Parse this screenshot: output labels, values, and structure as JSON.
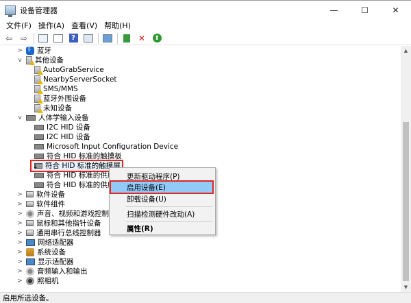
{
  "window": {
    "title": "设备管理器",
    "minimize_glyph": "—",
    "maximize_glyph": "☐",
    "close_glyph": "✕"
  },
  "menu": [
    "文件(F)",
    "操作(A)",
    "查看(V)",
    "帮助(H)"
  ],
  "toolbar": {
    "back_glyph": "⇦",
    "forward_glyph": "⇨",
    "help_glyph": "?",
    "uninstall_glyph": "✕",
    "update_glyph": "⬆"
  },
  "tree": {
    "bluetooth": "蓝牙",
    "other_devices": "其他设备",
    "other_children": [
      "AutoGrabService",
      "NearbyServerSocket",
      "SMS/MMS",
      "蓝牙外围设备",
      "未知设备"
    ],
    "hid": "人体学输入设备",
    "hid_children": [
      "I2C HID 设备",
      "I2C HID 设备",
      "Microsoft Input Configuration Device",
      "符合 HID 标准的触摸板",
      "符合 HID 标准的触摸屏",
      "符合 HID 标准的供应商",
      "符合 HID 标准的供应商"
    ],
    "categories": [
      "软件设备",
      "软件组件",
      "声音、视频和游戏控制器",
      "鼠标和其他指针设备",
      "通用串行总线控制器",
      "网络适配器",
      "系统设备",
      "显示适配器",
      "音频输入和输出",
      "照相机"
    ]
  },
  "context_menu": {
    "update_driver": "更新驱动程序(P)",
    "enable_device": "启用设备(E)",
    "uninstall_device": "卸载设备(U)",
    "scan_hardware": "扫描检测硬件改动(A)",
    "properties": "属性(R)"
  },
  "status_bar": "启用所选设备。",
  "colors": {
    "highlight_outline": "#e0261f",
    "menu_highlight": "#91c9f7",
    "bluetooth_icon": "#1b66c9"
  }
}
